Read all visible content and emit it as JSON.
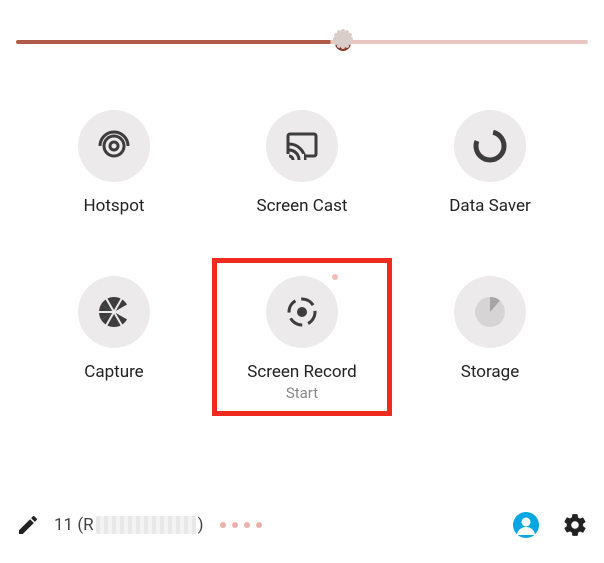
{
  "slider": {
    "value_pct": 55
  },
  "tiles": [
    {
      "label": "Hotspot",
      "icon": "hotspot-icon"
    },
    {
      "label": "Screen Cast",
      "icon": "cast-icon"
    },
    {
      "label": "Data Saver",
      "icon": "data-saver-icon"
    },
    {
      "label": "Capture",
      "icon": "aperture-icon"
    },
    {
      "label": "Screen Record",
      "icon": "record-icon",
      "sublabel": "Start",
      "highlighted": true
    },
    {
      "label": "Storage",
      "icon": "storage-pie-icon"
    }
  ],
  "bottom": {
    "version_prefix": "11 (R",
    "version_suffix": ")",
    "page_dots": 4
  },
  "colors": {
    "accent_track": "#b05a4a",
    "highlight": "#ee2b1e",
    "account": "#05a6e1"
  }
}
